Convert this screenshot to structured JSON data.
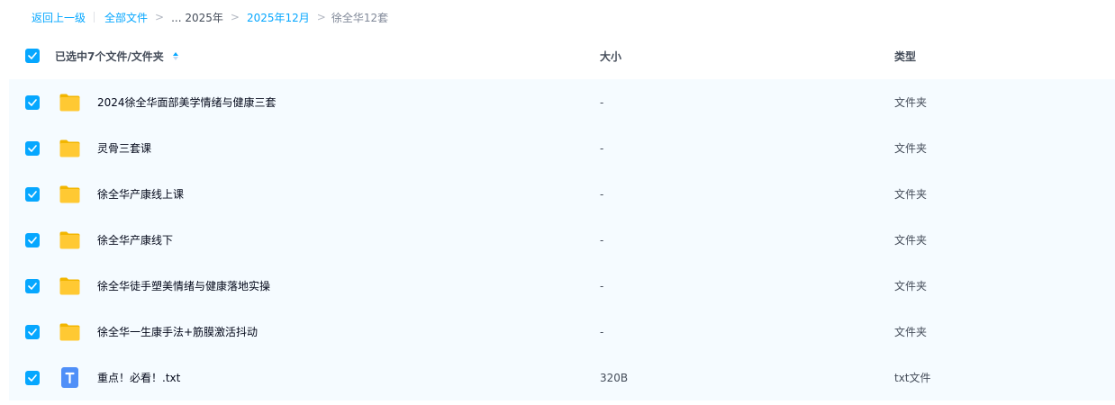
{
  "breadcrumb": {
    "back_label": "返回上一级",
    "items": [
      "全部文件",
      "... 2025年",
      "2025年12月"
    ],
    "current": "徐全华12套",
    "separator": ">"
  },
  "header": {
    "selection_label": "已选中7个文件/文件夹",
    "size_label": "大小",
    "type_label": "类型",
    "all_checked": true
  },
  "rows": [
    {
      "name": "2024徐全华面部美学情绪与健康三套",
      "size": "-",
      "type": "文件夹",
      "icon": "folder-icon",
      "checked": true
    },
    {
      "name": "灵骨三套课",
      "size": "-",
      "type": "文件夹",
      "icon": "folder-icon",
      "checked": true
    },
    {
      "name": "徐全华产康线上课",
      "size": "-",
      "type": "文件夹",
      "icon": "folder-icon",
      "checked": true
    },
    {
      "name": "徐全华产康线下",
      "size": "-",
      "type": "文件夹",
      "icon": "folder-icon",
      "checked": true
    },
    {
      "name": "徐全华徒手塑美情绪与健康落地实操",
      "size": "-",
      "type": "文件夹",
      "icon": "folder-icon",
      "checked": true
    },
    {
      "name": "徐全华一生康手法+筋膜激活抖动",
      "size": "-",
      "type": "文件夹",
      "icon": "folder-icon",
      "checked": true
    },
    {
      "name": "重点！必看！.txt",
      "size": "320B",
      "type": "txt文件",
      "icon": "text-file-icon",
      "checked": true
    }
  ],
  "colors": {
    "accent": "#06a7ff",
    "selected_row_bg": "#f5fbff",
    "folder": "#ffc933",
    "txt_icon": "#4f8ff8"
  }
}
